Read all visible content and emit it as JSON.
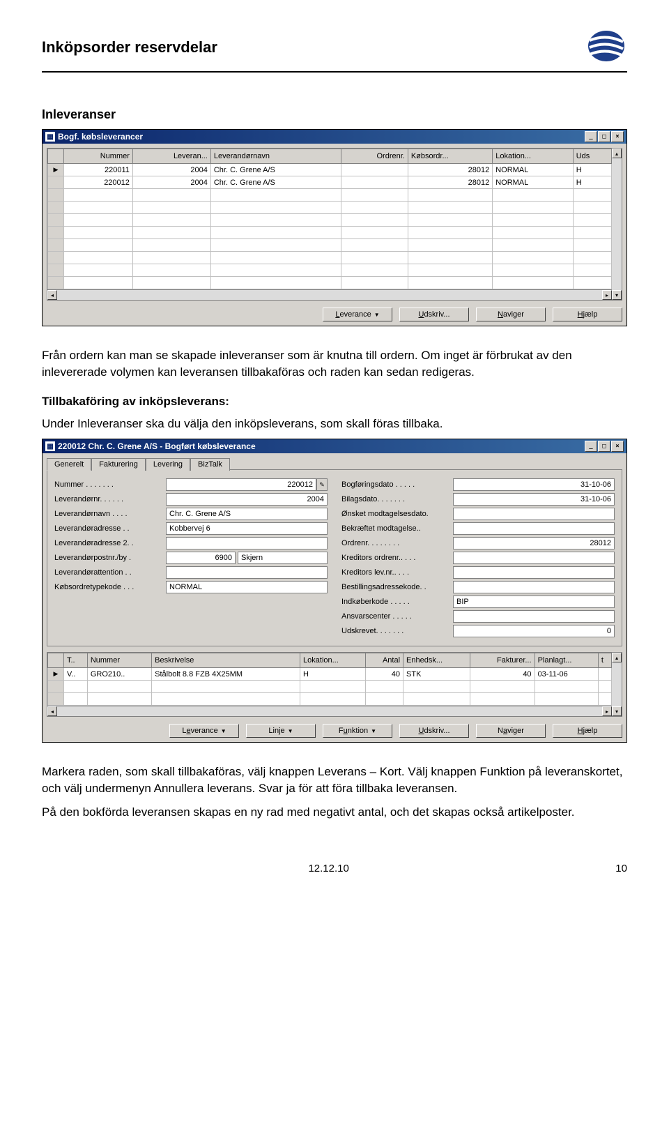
{
  "header": {
    "title": "Inköpsorder reservdelar"
  },
  "section1": {
    "heading": "Inleveranser",
    "para1": "Från ordern kan man se skapade inleveranser som är knutna till ordern. Om inget är förbrukat av den inlevererade volymen kan leveransen tillbakaföras och raden kan sedan redigeras.",
    "subheading": "Tillbakaföring av inköpsleverans:",
    "para2": "Under Inleveranser ska du välja den inköpsleverans, som skall föras tillbaka.",
    "para3": "Markera raden, som skall tillbakaföras, välj knappen Leverans – Kort. Välj knappen Funktion på leveranskortet, och välj undermenyn Annullera leverans. Svar ja för att föra tillbaka leveransen.",
    "para4": "På den bokförda leveransen skapas en ny rad med negativt antal, och det skapas också artikelposter."
  },
  "win1": {
    "title": "Bogf. købsleverancer",
    "columns": [
      "Nummer",
      "Leveran...",
      "Leverandørnavn",
      "Ordrenr.",
      "Købsordr...",
      "Lokation...",
      "Uds"
    ],
    "rows": [
      {
        "nummer": "220011",
        "leveran": "2004",
        "navn": "Chr. C. Grene A/S",
        "ordre": "",
        "kobs": "28012",
        "lok": "NORMAL",
        "ext": "H"
      },
      {
        "nummer": "220012",
        "leveran": "2004",
        "navn": "Chr. C. Grene A/S",
        "ordre": "",
        "kobs": "28012",
        "lok": "NORMAL",
        "ext": "H"
      }
    ],
    "buttons": [
      "Leverance",
      "Udskriv...",
      "Naviger",
      "Hjælp"
    ]
  },
  "win2": {
    "title": "220012 Chr. C. Grene A/S - Bogført købsleverance",
    "tabs": [
      "Generelt",
      "Fakturering",
      "Levering",
      "BizTalk"
    ],
    "left": {
      "Nummer": "220012",
      "Leverandørnr.": "2004",
      "Leverandørnavn": "Chr. C. Grene A/S",
      "Leverandøradresse": "Kobbervej 6",
      "Leverandøradresse 2": "",
      "Leverandørpostnr./by.": {
        "zip": "6900",
        "city": "Skjern"
      },
      "Leverandørattention": "",
      "Købsordretypekode": "NORMAL"
    },
    "right": {
      "Bogføringsdato": "31-10-06",
      "Bilagsdato.": "31-10-06",
      "Ønsket modtagelsesdato.": "",
      "Bekræftet modtagelse..": "",
      "Ordrenr.": "28012",
      "Kreditors ordrenr.": "",
      "Kreditors lev.nr..": "",
      "Bestillingsadressekode.": "",
      "Indkøberkode": "BIP",
      "Ansvarscenter": "",
      "Udskrevet.": "0"
    },
    "lineCols": [
      "T..",
      "Nummer",
      "Beskrivelse",
      "Lokation...",
      "Antal",
      "Enhedsk...",
      "Fakturer...",
      "Planlagt...",
      "t"
    ],
    "lines": [
      {
        "t": "V..",
        "nummer": "GRO210..",
        "besk": "Stålbolt 8.8 FZB 4X25MM",
        "lok": "H",
        "antal": "40",
        "enhed": "STK",
        "fakt": "40",
        "plan": "03-11-06"
      }
    ],
    "buttons": [
      "Leverance",
      "Linje",
      "Funktion",
      "Udskriv...",
      "Naviger",
      "Hjælp"
    ]
  },
  "footer": {
    "date": "12.12.10",
    "page": "10"
  }
}
